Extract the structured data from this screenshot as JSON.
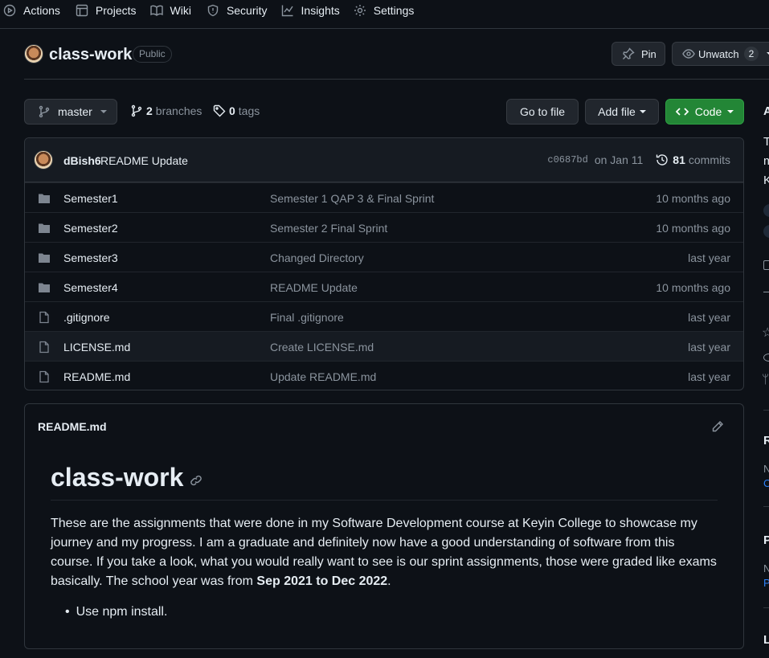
{
  "topnav": [
    {
      "label": "Actions",
      "icon": "play-icon"
    },
    {
      "label": "Projects",
      "icon": "table-icon"
    },
    {
      "label": "Wiki",
      "icon": "book-icon"
    },
    {
      "label": "Security",
      "icon": "shield-icon"
    },
    {
      "label": "Insights",
      "icon": "graph-icon"
    },
    {
      "label": "Settings",
      "icon": "gear-icon"
    }
  ],
  "repo": {
    "name": "class-work",
    "visibility": "Public",
    "pin_label": "Pin",
    "unwatch_label": "Unwatch",
    "watch_count": "2"
  },
  "branchbar": {
    "branch": "master",
    "branches_count": "2",
    "branches_label": "branches",
    "tags_count": "0",
    "tags_label": "tags",
    "go_to_file": "Go to file",
    "add_file": "Add file",
    "code": "Code"
  },
  "commit": {
    "author": "dBish6",
    "message": "README Update",
    "sha": "c0687bd",
    "date": "on Jan 11",
    "commits_count": "81",
    "commits_label": "commits"
  },
  "files": [
    {
      "type": "dir",
      "name": "Semester1",
      "message": "Semester 1 QAP 3 & Final Sprint",
      "age": "10 months ago"
    },
    {
      "type": "dir",
      "name": "Semester2",
      "message": "Semester 2 Final Sprint",
      "age": "10 months ago"
    },
    {
      "type": "dir",
      "name": "Semester3",
      "message": "Changed Directory",
      "age": "last year"
    },
    {
      "type": "dir",
      "name": "Semester4",
      "message": "README Update",
      "age": "10 months ago"
    },
    {
      "type": "file",
      "name": ".gitignore",
      "message": "Final .gitignore",
      "age": "last year"
    },
    {
      "type": "file",
      "name": "LICENSE.md",
      "message": "Create LICENSE.md",
      "age": "last year"
    },
    {
      "type": "file",
      "name": "README.md",
      "message": "Update README.md",
      "age": "last year"
    }
  ],
  "readme": {
    "filename": "README.md",
    "heading": "class-work",
    "para_main": "These are the assignments that were done in my Software Development course at Keyin College to showcase my journey and my progress. I am a graduate and definitely now have a good understanding of software from this course. If you take a look, what you would really want to see is our sprint assignments, those were graded like exams basically. The school year was from ",
    "para_bold": "Sep 2021 to Dec 2022",
    "para_end": ".",
    "bullets": [
      "Use npm install."
    ]
  },
  "sidebar_letters": [
    "A",
    "T",
    "m",
    "K",
    "R",
    "N",
    "C",
    "P",
    "N",
    "P",
    "L"
  ],
  "colors": {
    "accent_green": "#238636",
    "folder": "#7d8590",
    "link": "#2f81f7"
  }
}
